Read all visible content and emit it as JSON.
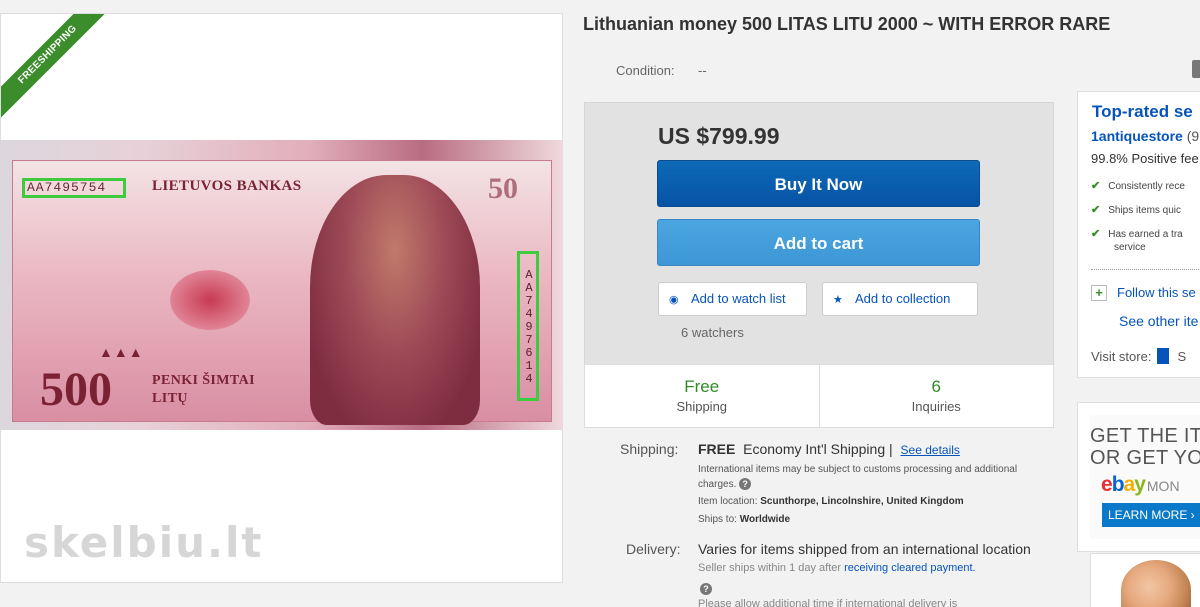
{
  "listing": {
    "ribbon": "FREESHIPPING",
    "title": "Lithuanian money 500 LITAS LITU 2000 ~ WITH ERROR RARE",
    "condition_label": "Condition:",
    "condition_value": "--",
    "watermark": "skelbiu.lt"
  },
  "banknote": {
    "serial_left": "AA7495754",
    "bank_name": "LIETUVOS BANKAS",
    "denomination": "500",
    "denomination_top": "50",
    "serial_right": "AA7497614",
    "triangles": "▲▲▲",
    "words_line1": "PENKI ŠIMTAI",
    "words_line2": "LITŲ"
  },
  "buybox": {
    "price": "US $799.99",
    "buy_now": "Buy It Now",
    "add_to_cart": "Add to cart",
    "watch_list": "Add to watch list",
    "collection": "Add to collection",
    "watchers": "6 watchers",
    "stats": [
      {
        "big": "Free",
        "small": "Shipping"
      },
      {
        "big": "6",
        "small": "Inquiries"
      }
    ]
  },
  "shipping": {
    "label": "Shipping:",
    "free": "FREE",
    "method": "Economy Int'l Shipping |",
    "see_details": "See details",
    "note": "International items may be subject to customs processing and additional charges.",
    "location_label": "Item location:",
    "location_value": "Scunthorpe, Lincolnshire, United Kingdom",
    "ships_to_label": "Ships to:",
    "ships_to_value": "Worldwide"
  },
  "delivery": {
    "label": "Delivery:",
    "value": "Varies for items shipped from an international location",
    "note_prefix": "Seller ships within 1 day after",
    "note_link": "receiving cleared payment.",
    "more": "Please allow additional time if international delivery is"
  },
  "seller": {
    "title": "Top-rated se",
    "name": "1antiquestore",
    "name_suffix": "(9",
    "feedback": "99.8% Positive fee",
    "perks": [
      "Consistently rece",
      "Ships items quic",
      "Has earned a tra"
    ],
    "perk3_cont": "service",
    "follow": "Follow this se",
    "see_other": "See other ite",
    "visit_store": "Visit store:",
    "store_initial": "S"
  },
  "ad": {
    "line1": "GET THE IT",
    "line2": "OR GET YO",
    "ebay": [
      "e",
      "b",
      "a",
      "y"
    ],
    "money": "MON",
    "learn_more": "LEARN MORE ›"
  },
  "colors": {
    "primary_blue": "#0753a6",
    "cart_blue": "#3d96d6",
    "link_blue": "#0654ba",
    "free_green": "#2f8c28",
    "ribbon_green": "#3a8d2a"
  }
}
